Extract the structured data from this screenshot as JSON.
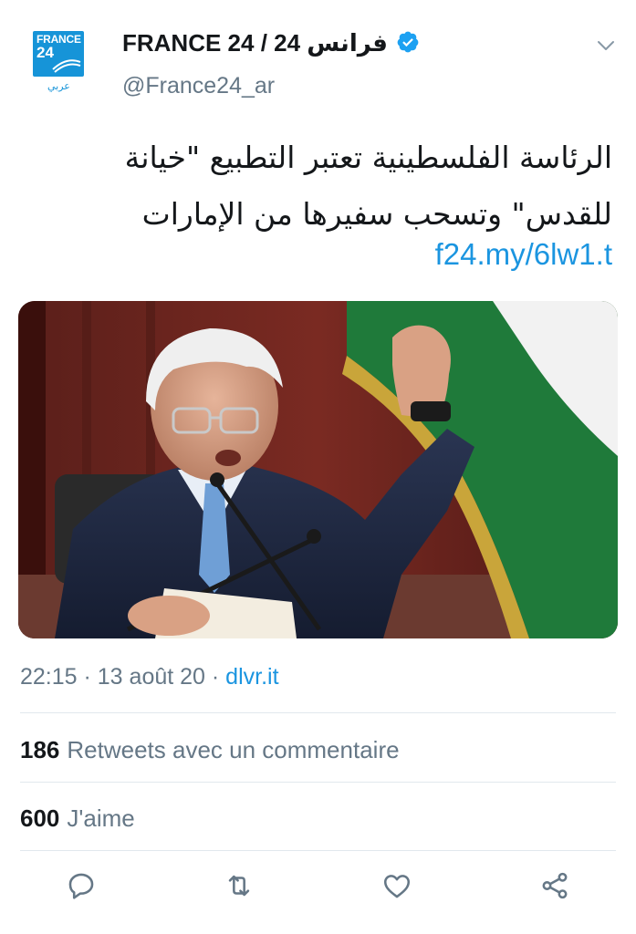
{
  "account": {
    "logo_text": "FRANCE",
    "logo_number": "24",
    "logo_arabic": "عربي",
    "display_name": "FRANCE 24 / فرانس 24",
    "handle": "@France24_ar"
  },
  "tweet": {
    "text": "الرئاسة الفلسطينية تعتبر التطبيع \"خيانة للقدس\" وتسحب سفيرها من الإمارات",
    "link": "f24.my/6lw1.t"
  },
  "meta": {
    "time": "22:15",
    "separator1": " · ",
    "date": "13 août 20",
    "separator2": " · ",
    "source": "dlvr.it"
  },
  "stats": {
    "retweets_count": "186",
    "retweets_label": "Retweets avec un commentaire",
    "likes_count": "600",
    "likes_label": "J'aime"
  },
  "colors": {
    "accent": "#1b95e0",
    "muted": "#657786",
    "divider": "#e1e8ed",
    "logo_blue": "#1694d8"
  },
  "icons": {
    "reply": "reply-icon",
    "retweet": "retweet-icon",
    "like": "like-icon",
    "share": "share-icon",
    "verified": "verified-badge-icon",
    "more": "chevron-down-icon"
  }
}
